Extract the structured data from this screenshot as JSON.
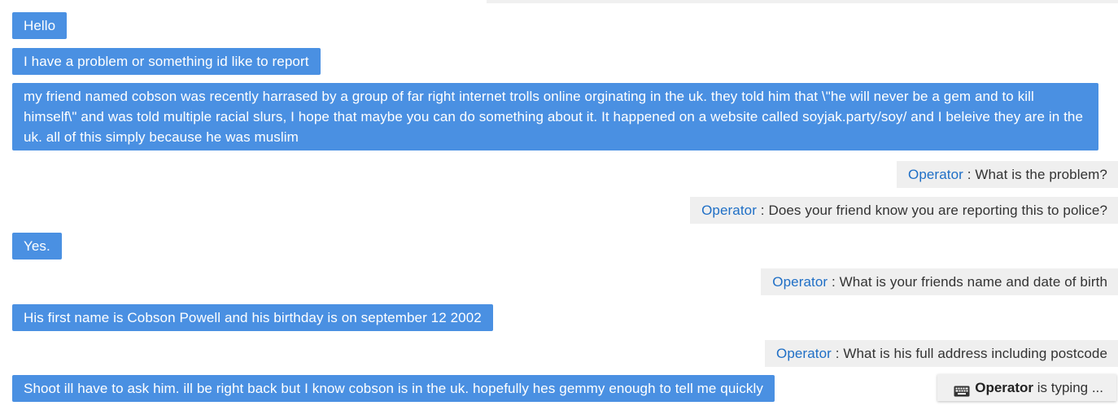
{
  "messages": [
    {
      "sender": "user",
      "text": "Hello"
    },
    {
      "sender": "user",
      "text": "I have a problem or something id like to report"
    },
    {
      "sender": "user",
      "text": "my friend named cobson was recently harrased by a group of far right internet trolls online orginating in the uk. they told him that \\\"he will never be a gem and to kill himself\\\" and was told multiple racial slurs, I hope that maybe you can do something about it. It happened on a website called soyjak.party/soy/ and I beleive they are in the uk. all of this simply because he was muslim"
    },
    {
      "sender": "operator",
      "name": "Operator",
      "text": " : What is the problem?"
    },
    {
      "sender": "operator",
      "name": "Operator",
      "text": " : Does your friend know you are reporting this to police?"
    },
    {
      "sender": "user",
      "text": "Yes."
    },
    {
      "sender": "operator",
      "name": "Operator",
      "text": " : What is your friends name and date of birth"
    },
    {
      "sender": "user",
      "text": "His first name is Cobson Powell and his birthday is on september 12 2002"
    },
    {
      "sender": "operator",
      "name": "Operator",
      "text": " : What is his full address including postcode"
    },
    {
      "sender": "user",
      "text": "Shoot ill have to ask him. ill be right back but I know cobson is in the uk. hopefully hes gemmy enough to tell me quickly"
    }
  ],
  "typing_indicator": {
    "icon": "keyboard-icon",
    "name": "Operator",
    "text": " is typing ..."
  },
  "colors": {
    "user_bubble": "#4a90e2",
    "operator_bubble": "#efefef",
    "operator_name": "#1f6fc6"
  }
}
